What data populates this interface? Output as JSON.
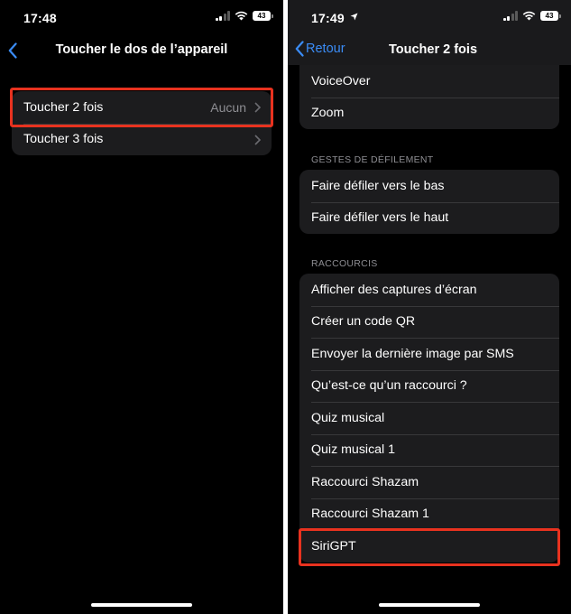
{
  "left": {
    "status": {
      "time": "17:48",
      "battery": "43"
    },
    "nav": {
      "title": "Toucher le dos de l’appareil"
    },
    "rows": [
      {
        "label": "Toucher 2 fois",
        "value": "Aucun"
      },
      {
        "label": "Toucher 3 fois",
        "value": ""
      }
    ]
  },
  "right": {
    "status": {
      "time": "17:49",
      "battery": "43"
    },
    "nav": {
      "back_label": "Retour",
      "title": "Toucher 2 fois"
    },
    "group1": [
      "VoiceOver",
      "Zoom"
    ],
    "section2_header": "GESTES DE DÉFILEMENT",
    "group2": [
      "Faire défiler vers le bas",
      "Faire défiler vers le haut"
    ],
    "section3_header": "RACCOURCIS",
    "group3": [
      "Afficher des captures d’écran",
      "Créer un code QR",
      "Envoyer la dernière image par SMS",
      "Qu’est-ce qu’un raccourci ?",
      "Quiz musical",
      "Quiz musical 1",
      "Raccourci Shazam",
      "Raccourci Shazam 1",
      "SiriGPT"
    ]
  },
  "colors": {
    "highlight": "#e8321f",
    "accent": "#3b8cf6",
    "cell": "#1c1c1e",
    "secondary_text": "#8e8e93"
  }
}
